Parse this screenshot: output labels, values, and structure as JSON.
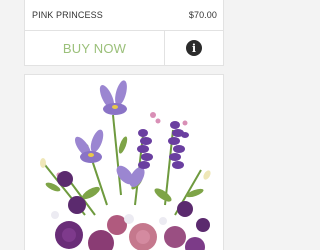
{
  "product": {
    "name": "PINK PRINCESS",
    "price": "$70.00",
    "buy_label": "BUY NOW",
    "info_icon": "info-icon",
    "image_icon": "flower-arrangement-image"
  },
  "colors": {
    "buy_text": "#9bc07a",
    "info_bg": "#2b2b2b",
    "border": "#e2e2e2"
  }
}
